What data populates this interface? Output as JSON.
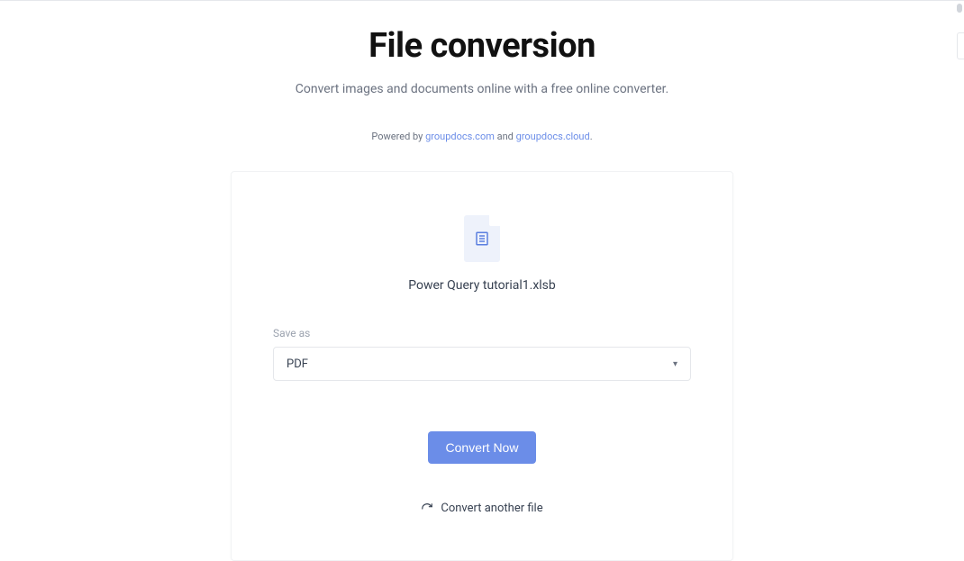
{
  "header": {
    "title": "File conversion",
    "subtitle": "Convert images and documents online with a free online converter.",
    "powered_prefix": "Powered by ",
    "powered_link1": "groupdocs.com",
    "powered_mid": " and ",
    "powered_link2": "groupdocs.cloud",
    "powered_suffix": "."
  },
  "file": {
    "name": "Power Query tutorial1.xlsb"
  },
  "saveas": {
    "label": "Save as",
    "selected": "PDF"
  },
  "actions": {
    "convert": "Convert Now",
    "another": "Convert another file"
  }
}
